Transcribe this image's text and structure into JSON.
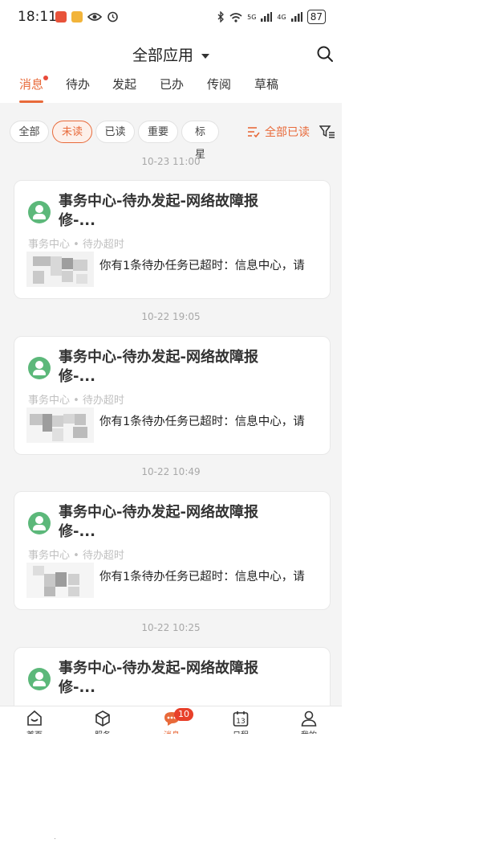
{
  "status_bar": {
    "time": "18:11",
    "battery": "87",
    "signal_1": "5G",
    "signal_2": "4G"
  },
  "header": {
    "title": "全部应用"
  },
  "tabs": [
    {
      "label": "消息",
      "active": true,
      "dot": true
    },
    {
      "label": "待办"
    },
    {
      "label": "发起"
    },
    {
      "label": "已办"
    },
    {
      "label": "传阅"
    },
    {
      "label": "草稿"
    }
  ],
  "filters": {
    "chips": [
      {
        "label": "全部"
      },
      {
        "label": "未读",
        "active": true
      },
      {
        "label": "已读"
      },
      {
        "label": "重要"
      },
      {
        "label": "标星"
      }
    ],
    "mark_all_read": "全部已读"
  },
  "messages": [
    {
      "date": "10-23 11:00",
      "title_line1": "事务中心-待办发起-网络故障报",
      "title_line2": "修-...",
      "subtitle": "事务中心 • 待办超时",
      "body": "你有1条待办任务已超时：信息中心，请"
    },
    {
      "date": "10-22 19:05",
      "title_line1": "事务中心-待办发起-网络故障报",
      "title_line2": "修-...",
      "subtitle": "事务中心 • 待办超时",
      "body": "你有1条待办任务已超时：信息中心，请"
    },
    {
      "date": "10-22 10:49",
      "title_line1": "事务中心-待办发起-网络故障报",
      "title_line2": "修-...",
      "subtitle": "事务中心 • 待办超时",
      "body": "你有1条待办任务已超时：信息中心，请"
    },
    {
      "date": "10-22 10:25",
      "title_line1": "事务中心-待办发起-网络故障报",
      "title_line2": "修-..."
    }
  ],
  "bottom_nav": [
    {
      "label": "首页",
      "icon": "home-icon"
    },
    {
      "label": "服务",
      "icon": "cube-icon"
    },
    {
      "label": "消息",
      "icon": "chat-icon",
      "active": true,
      "badge": "10"
    },
    {
      "label": "日程",
      "icon": "calendar-icon",
      "calendar_day": "13"
    },
    {
      "label": "我的",
      "icon": "person-icon"
    }
  ],
  "colors": {
    "accent": "#e86a3a",
    "badge": "#e8402a",
    "avatar": "#5cb87a"
  }
}
